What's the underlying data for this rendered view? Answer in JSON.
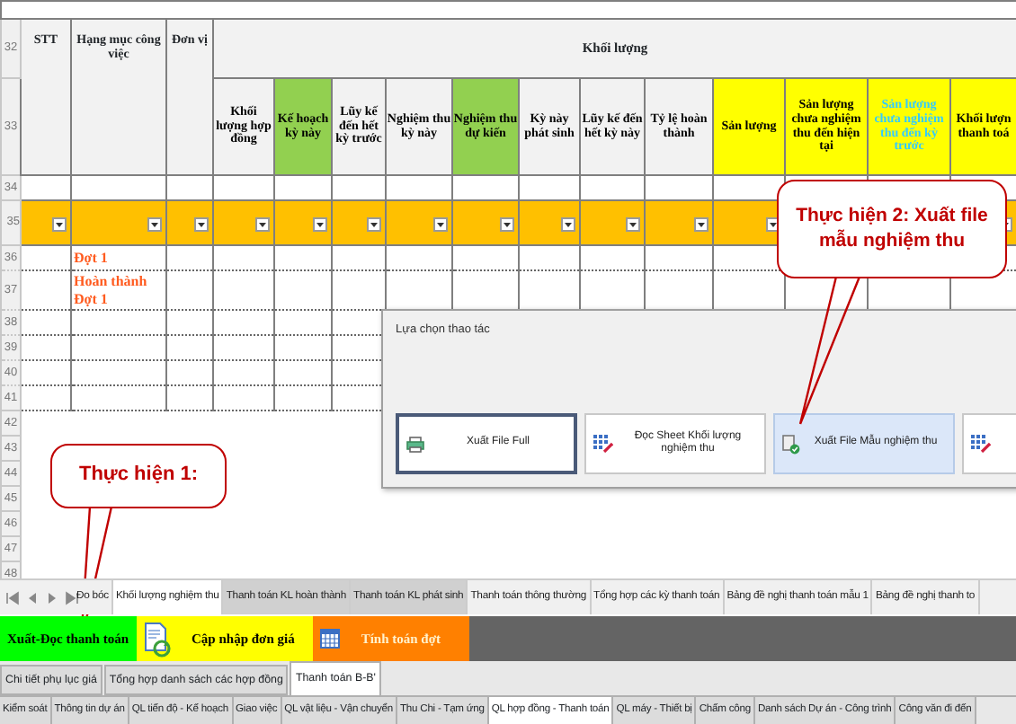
{
  "sheet": {
    "header_rows": [
      "32",
      "33"
    ],
    "header_group": "Khối lượng",
    "fixed_columns": [
      "STT",
      "Hạng mục công việc",
      "Đơn vị"
    ],
    "columns": [
      {
        "label": "Khối lượng hợp đồng",
        "color": "#f2f2f2",
        "kind": "standard"
      },
      {
        "label": "Kế hoạch kỳ này",
        "color": "#92d050",
        "kind": "standard"
      },
      {
        "label": "Lũy kế đến hết kỳ trước",
        "color": "#f2f2f2",
        "kind": "standard"
      },
      {
        "label": "Nghiệm thu kỳ này",
        "color": "#f2f2f2",
        "kind": "standard"
      },
      {
        "label": "Nghiệm thu dự kiến",
        "color": "#92d050",
        "kind": "standard"
      },
      {
        "label": "Kỳ này phát sinh",
        "color": "#f2f2f2",
        "kind": "standard"
      },
      {
        "label": "Lũy kế đến hết kỳ này",
        "color": "#f2f2f2",
        "kind": "standard"
      },
      {
        "label": "Tỷ lệ hoàn thành",
        "color": "#f2f2f2",
        "kind": "standard"
      },
      {
        "label": "Sản lượng",
        "color": "#ffff00",
        "kind": "standard"
      },
      {
        "label": "Sản lượng chưa nghiệm thu đến hiện tại",
        "color": "#ffff00",
        "kind": "standard"
      },
      {
        "label": "Sản lượng chưa nghiệm thu đến kỳ trước",
        "color": "#ffff00",
        "kind": "muted"
      },
      {
        "label": "Khối lượn thanh toá",
        "color": "#ffff00",
        "kind": "standard"
      }
    ],
    "rows": [
      {
        "number": "34",
        "kind": "blank"
      },
      {
        "number": "35",
        "kind": "filter"
      },
      {
        "number": "36",
        "kind": "data",
        "item": "Đợt 1"
      },
      {
        "number": "37",
        "kind": "data",
        "item": "Hoàn thành Đợt 1"
      },
      {
        "number": "38",
        "kind": "data"
      },
      {
        "number": "39",
        "kind": "data"
      },
      {
        "number": "40",
        "kind": "data"
      },
      {
        "number": "41",
        "kind": "data"
      },
      {
        "number": "42",
        "kind": "empty"
      },
      {
        "number": "43",
        "kind": "empty"
      },
      {
        "number": "44",
        "kind": "empty"
      },
      {
        "number": "45",
        "kind": "empty"
      },
      {
        "number": "46",
        "kind": "empty"
      },
      {
        "number": "47",
        "kind": "empty"
      },
      {
        "number": "48",
        "kind": "empty"
      }
    ]
  },
  "dialog": {
    "title": "Lựa chọn thao tác",
    "buttons": [
      {
        "label": "Xuất File Full",
        "kind": "printer",
        "focused": true,
        "selected": false
      },
      {
        "label": "Đọc Sheet Khối lượng nghiệm thu",
        "kind": "grid",
        "focused": false,
        "selected": false
      },
      {
        "label": "Xuất File Mẫu nghiệm thu",
        "kind": "document-check",
        "focused": false,
        "selected": true
      },
      {
        "kind": "grid",
        "focused": false,
        "selected": false
      }
    ]
  },
  "callouts": [
    {
      "text": "Thực hiện 2: Xuất file mẫu nghiệm thu"
    },
    {
      "text": "Thực hiện 1:"
    }
  ],
  "sheet_tabs": [
    {
      "label": "Đo bóc",
      "selected": false,
      "highlighted": false
    },
    {
      "label": "Khối lượng nghiệm thu",
      "selected": true,
      "highlighted": false
    },
    {
      "label": "Thanh toán KL hoàn thành",
      "selected": false,
      "highlighted": true
    },
    {
      "label": "Thanh toán KL phát sinh",
      "selected": false,
      "highlighted": true
    },
    {
      "label": "Thanh toán thông thường",
      "selected": false,
      "highlighted": false
    },
    {
      "label": "Tổng hợp các kỳ thanh toán",
      "selected": false,
      "highlighted": false
    },
    {
      "label": "Bảng đề nghị thanh toán mẫu 1",
      "selected": false,
      "highlighted": false
    },
    {
      "label": "Bảng đề nghị thanh to",
      "selected": false,
      "highlighted": false
    }
  ],
  "toolbar": [
    {
      "label": "Xuất-Đọc thanh toán",
      "kind": "plain",
      "color": "#00ff00"
    },
    {
      "label": "Cập nhập đơn giá",
      "kind": "document-refresh",
      "color": "#ffff00"
    },
    {
      "label": "Tính toán đợt",
      "kind": "calendar",
      "color": "#ff8000"
    }
  ],
  "sub_tabs": [
    {
      "label": "Chi tiết phụ lục giá",
      "selected": false
    },
    {
      "label": "Tổng hợp danh sách các hợp đồng",
      "selected": false
    },
    {
      "label": "Thanh toán B-B'",
      "selected": true
    }
  ],
  "module_tabs": [
    {
      "label": "Kiểm soát",
      "selected": false
    },
    {
      "label": "Thông tin dự án",
      "selected": false
    },
    {
      "label": "QL tiến độ - Kế hoạch",
      "selected": false
    },
    {
      "label": "Giao việc",
      "selected": false
    },
    {
      "label": "QL vật liệu - Vận chuyển",
      "selected": false
    },
    {
      "label": "Thu Chi - Tạm ứng",
      "selected": false
    },
    {
      "label": "QL hợp đồng - Thanh toán",
      "selected": true
    },
    {
      "label": "QL máy - Thiết bị",
      "selected": false
    },
    {
      "label": "Chấm công",
      "selected": false
    },
    {
      "label": "Danh sách Dự án - Công trình",
      "selected": false
    },
    {
      "label": "Công văn đi đến",
      "selected": false
    }
  ]
}
